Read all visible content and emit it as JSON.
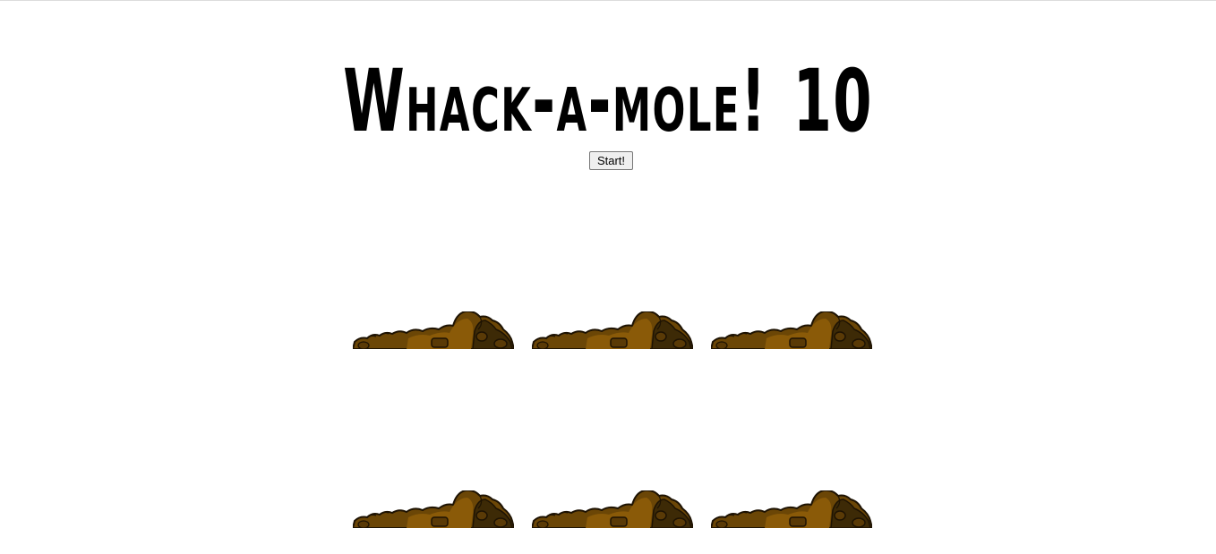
{
  "game": {
    "title": "Whack-a-mole!",
    "score": "10",
    "start_label": "Start!"
  },
  "holes": [
    {
      "id": "hole-1"
    },
    {
      "id": "hole-2"
    },
    {
      "id": "hole-3"
    },
    {
      "id": "hole-4"
    },
    {
      "id": "hole-5"
    },
    {
      "id": "hole-6"
    }
  ],
  "colors": {
    "dirt_light": "#8a5a08",
    "dirt_mid": "#6b4606",
    "dirt_dark": "#3d2a06",
    "outline": "#1e1303"
  }
}
